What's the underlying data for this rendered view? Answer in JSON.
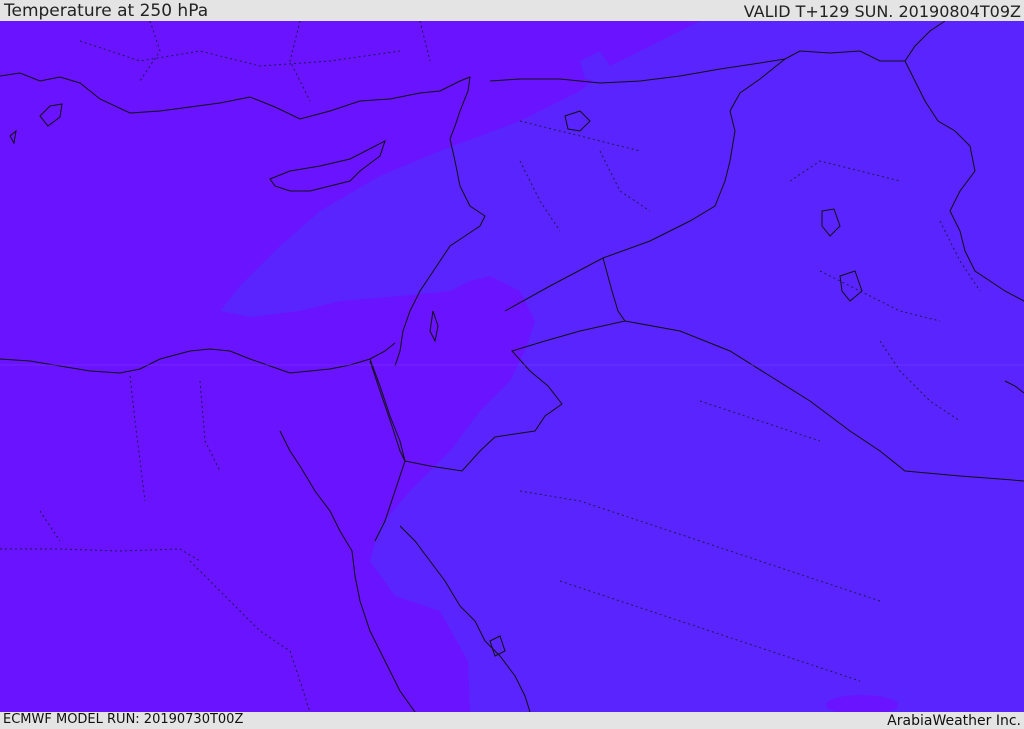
{
  "header": {
    "title": "Temperature at 250 hPa",
    "valid": "VALID T+129 SUN. 20190804T09Z"
  },
  "footer": {
    "model_run": "ECMWF MODEL RUN: 20190730T00Z",
    "credit": "ArabiaWeather Inc."
  },
  "map": {
    "colors": {
      "warmer_band": "#6a13fe",
      "cooler_band": "#5a24fe",
      "coastline": "#111111",
      "border": "#111111",
      "admin_border": "#1a1a5a"
    }
  }
}
